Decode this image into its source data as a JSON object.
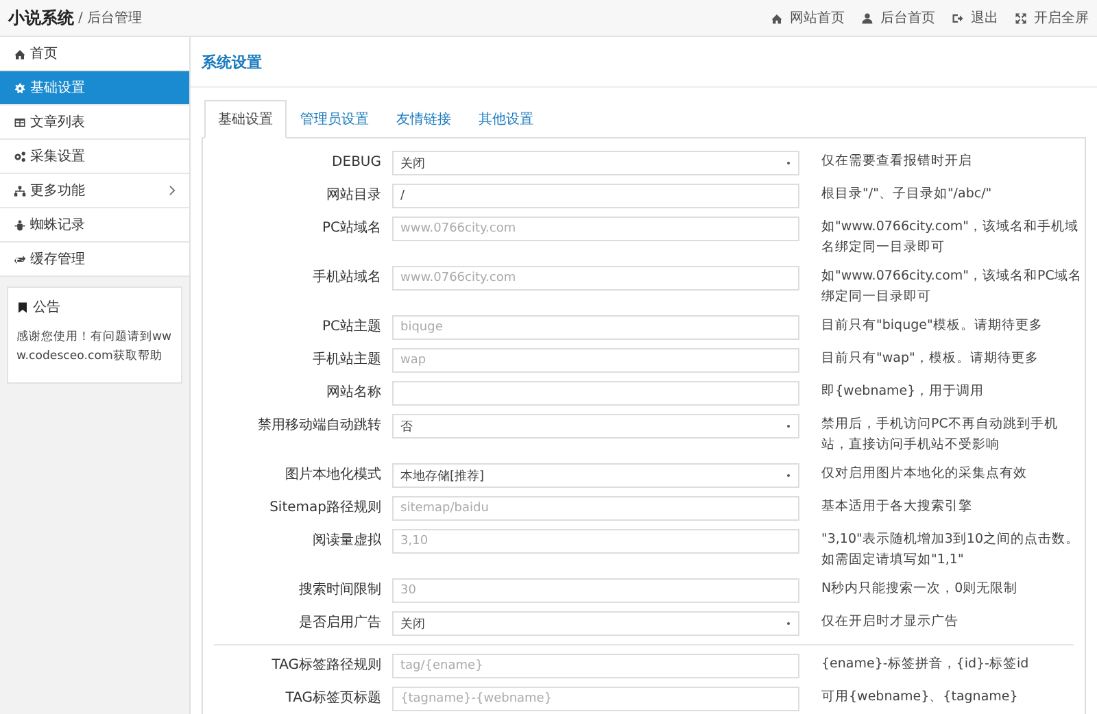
{
  "header": {
    "brand": "小说系统",
    "subtitle": "/ 后台管理",
    "links": [
      {
        "label": "网站首页"
      },
      {
        "label": "后台首页"
      },
      {
        "label": "退出"
      },
      {
        "label": "开启全屏"
      }
    ]
  },
  "sidebar": {
    "items": [
      {
        "label": "首页",
        "selected": false,
        "expandable": false
      },
      {
        "label": "基础设置",
        "selected": true,
        "expandable": false
      },
      {
        "label": "文章列表",
        "selected": false,
        "expandable": false
      },
      {
        "label": "采集设置",
        "selected": false,
        "expandable": false
      },
      {
        "label": "更多功能",
        "selected": false,
        "expandable": true
      },
      {
        "label": "蜘蛛记录",
        "selected": false,
        "expandable": false
      },
      {
        "label": "缓存管理",
        "selected": false,
        "expandable": false
      }
    ],
    "notice": {
      "title": "公告",
      "text": "感谢您使用！有问题请到www.codesceo.com获取帮助"
    }
  },
  "page_title": "系统设置",
  "tabs": [
    {
      "label": "基础设置",
      "selected": true
    },
    {
      "label": "管理员设置",
      "selected": false
    },
    {
      "label": "友情链接",
      "selected": false
    },
    {
      "label": "其他设置",
      "selected": false
    }
  ],
  "sections": [
    [
      {
        "label": "DEBUG",
        "kind": "select",
        "value": "关闭",
        "hint": "仅在需要查看报错时开启"
      },
      {
        "label": "网站目录",
        "kind": "text",
        "value": "/",
        "hint": "根目录\"/\"、子目录如\"/abc/\""
      },
      {
        "label": "PC站域名",
        "kind": "text",
        "placeholder": "www.0766city.com",
        "hint": "如\"www.0766city.com\"，该域名和手机域名绑定同一目录即可"
      },
      {
        "label": "手机站域名",
        "kind": "text",
        "placeholder": "www.0766city.com",
        "hint": "如\"www.0766city.com\"，该域名和PC域名绑定同一目录即可"
      },
      {
        "label": "PC站主题",
        "kind": "text",
        "placeholder": "biquge",
        "hint": "目前只有\"biquge\"模板。请期待更多"
      },
      {
        "label": "手机站主题",
        "kind": "text",
        "placeholder": "wap",
        "hint": "目前只有\"wap\"，模板。请期待更多"
      },
      {
        "label": "网站名称",
        "kind": "text",
        "hint": "即{webname}，用于调用"
      },
      {
        "label": "禁用移动端自动跳转",
        "kind": "select",
        "value": "否",
        "hint": "禁用后，手机访问PC不再自动跳到手机站，直接访问手机站不受影响"
      },
      {
        "label": "图片本地化模式",
        "kind": "select",
        "value": "本地存储[推荐]",
        "hint": "仅对启用图片本地化的采集点有效"
      },
      {
        "label": "Sitemap路径规则",
        "kind": "text",
        "placeholder": "sitemap/baidu",
        "hint": "基本适用于各大搜索引擎"
      },
      {
        "label": "阅读量虚拟",
        "kind": "text",
        "placeholder": "3,10",
        "hint": "\"3,10\"表示随机增加3到10之间的点击数。如需固定请填写如\"1,1\""
      },
      {
        "label": "搜索时间限制",
        "kind": "text",
        "placeholder": "30",
        "hint": "N秒内只能搜索一次，0则无限制"
      },
      {
        "label": "是否启用广告",
        "kind": "select",
        "value": "关闭",
        "hint": "仅在开启时才显示广告"
      }
    ],
    [
      {
        "label": "TAG标签路径规则",
        "kind": "text",
        "placeholder": "tag/{ename}",
        "hint": "{ename}-标签拼音，{id}-标签id"
      },
      {
        "label": "TAG标签页标题",
        "kind": "text",
        "placeholder": "{tagname}-{webname}",
        "hint": "可用{webname}、{tagname}"
      }
    ]
  ]
}
